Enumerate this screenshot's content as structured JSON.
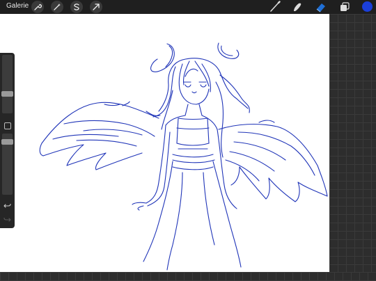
{
  "topbar": {
    "gallery_label": "Galerie",
    "left_icons": [
      "wrench-icon",
      "magic-wand-icon",
      "selection-icon",
      "transform-arrow-icon"
    ],
    "right_tools": [
      "brush-icon",
      "smudge-icon",
      "eraser-icon",
      "layers-icon"
    ],
    "active_tool": "eraser-icon",
    "accent_color": "#1f6fd6",
    "current_color": "#1b3fd9"
  },
  "sidebar": {
    "brush_size_level": 0.65,
    "opacity_level": 0.35
  },
  "canvas": {
    "background": "#ffffff",
    "stroke_color": "#1f34b8"
  }
}
